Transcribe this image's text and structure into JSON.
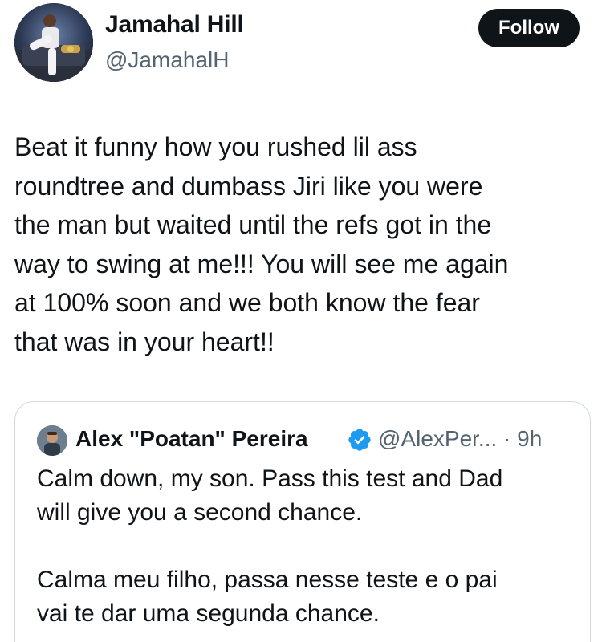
{
  "tweet": {
    "author": {
      "name": "Jamahal Hill",
      "handle": "@JamahalH"
    },
    "follow_label": "Follow",
    "text": "Beat it funny how you rushed lil ass\nroundtree and dumbass Jiri like you were\nthe man but waited until the refs got in the\nway to swing at me!!! You will see me again\nat 100% soon and we both know the fear\nthat was in your heart!!"
  },
  "quote": {
    "author": {
      "name": "Alex \"Poatan\" Pereira",
      "handle_time": "@AlexPer... · 9h",
      "verified": true
    },
    "text": "Calm down, my son. Pass this test and Dad\nwill give you a second chance.\n\nCalma meu filho, passa nesse teste e o pai\nvai te dar uma segunda chance."
  },
  "colors": {
    "text_primary": "#0f1419",
    "text_secondary": "#536471",
    "follow_bg": "#0f1419",
    "verified_blue": "#1d9bf0",
    "border": "#cfd9de"
  },
  "icons": {
    "verified": "verified-badge-icon"
  }
}
